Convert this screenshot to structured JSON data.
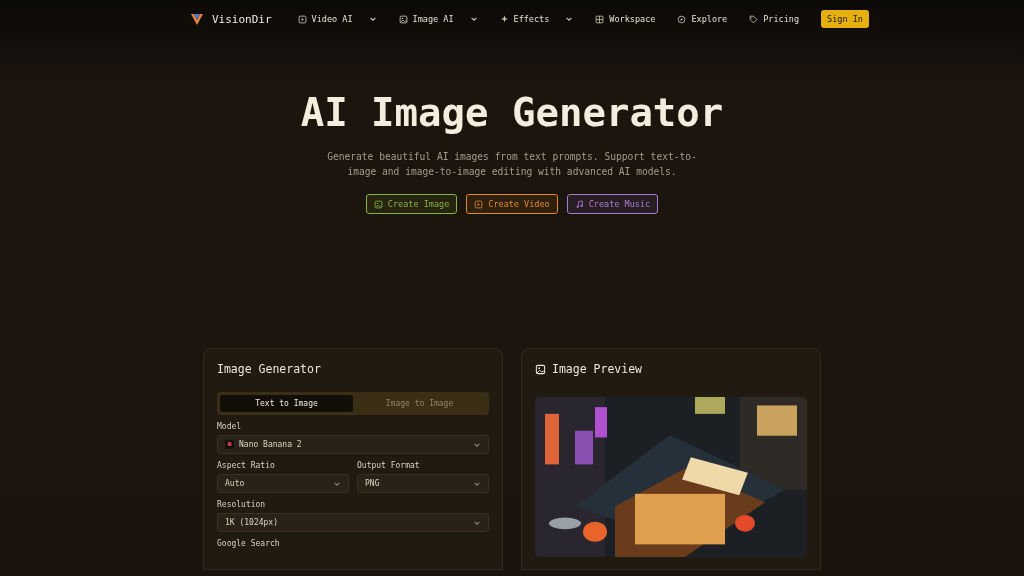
{
  "nav": {
    "brand": "VisionDir",
    "items": [
      {
        "label": "Video AI",
        "dropdown": true
      },
      {
        "label": "Image AI",
        "dropdown": true
      },
      {
        "label": "Effects",
        "dropdown": true
      },
      {
        "label": "Workspace",
        "dropdown": false
      },
      {
        "label": "Explore",
        "dropdown": false
      },
      {
        "label": "Pricing",
        "dropdown": false
      }
    ],
    "sign_in": "Sign In"
  },
  "hero": {
    "title": "AI Image Generator",
    "subtitle": "Generate beautiful AI images from text prompts. Support text-to-image and image-to-image editing with advanced AI models.",
    "buttons": [
      {
        "label": "Create Image",
        "color": "#86b33a"
      },
      {
        "label": "Create Video",
        "color": "#e08a2c"
      },
      {
        "label": "Create Music",
        "color": "#a979d8"
      }
    ]
  },
  "generator": {
    "title": "Image Generator",
    "tabs": [
      {
        "label": "Text to Image",
        "selected": true
      },
      {
        "label": "Image to Image",
        "selected": false
      }
    ],
    "rows": [
      [
        {
          "kind": "select-logo",
          "label": "Model",
          "value": "Nano Banana 2"
        }
      ],
      [
        {
          "kind": "select",
          "label": "Aspect Ratio",
          "value": "Auto"
        },
        {
          "kind": "select",
          "label": "Output Format",
          "value": "PNG"
        }
      ],
      [
        {
          "kind": "select",
          "label": "Resolution",
          "value": "1K (1024px)"
        }
      ],
      [
        {
          "kind": "label",
          "label": "Google Search"
        }
      ]
    ]
  },
  "preview": {
    "title": "Image Preview"
  }
}
